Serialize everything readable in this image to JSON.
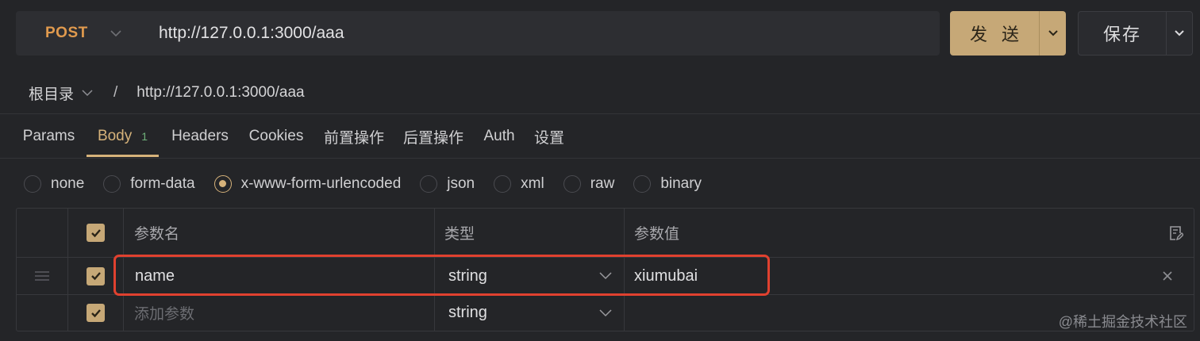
{
  "request": {
    "method": "POST",
    "url": "http://127.0.0.1:3000/aaa",
    "send_label": "发 送",
    "save_label": "保存"
  },
  "breadcrumb": {
    "root": "根目录",
    "separator": "/",
    "path": "http://127.0.0.1:3000/aaa"
  },
  "tabs": [
    {
      "label": "Params"
    },
    {
      "label": "Body",
      "badge": "1",
      "active": true
    },
    {
      "label": "Headers"
    },
    {
      "label": "Cookies"
    },
    {
      "label": "前置操作"
    },
    {
      "label": "后置操作"
    },
    {
      "label": "Auth"
    },
    {
      "label": "设置"
    }
  ],
  "body_types": [
    {
      "label": "none"
    },
    {
      "label": "form-data"
    },
    {
      "label": "x-www-form-urlencoded",
      "selected": true
    },
    {
      "label": "json"
    },
    {
      "label": "xml"
    },
    {
      "label": "raw"
    },
    {
      "label": "binary"
    }
  ],
  "table": {
    "headers": {
      "name": "参数名",
      "type": "类型",
      "value": "参数值"
    },
    "rows": [
      {
        "name": "name",
        "type": "string",
        "value": "xiumubai",
        "checked": true
      },
      {
        "name_placeholder": "添加参数",
        "type": "string",
        "checked": true
      }
    ]
  },
  "watermark": "@稀土掘金技术社区",
  "colors": {
    "accent": "#d6b27a",
    "send_button": "#c6a877",
    "method": "#e09a4e",
    "highlight": "#e0412f",
    "background": "#242528"
  }
}
